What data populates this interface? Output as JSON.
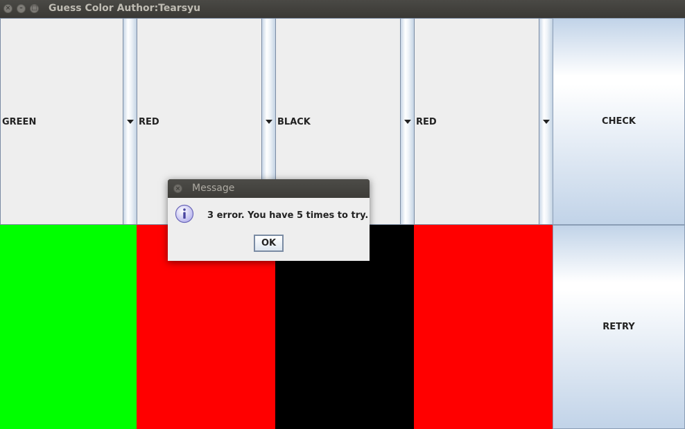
{
  "window": {
    "title": "Guess Color Author:Tearsyu",
    "controls": {
      "close": "×",
      "minimize": "–",
      "maximize": "□"
    }
  },
  "combos": [
    {
      "value": "GREEN"
    },
    {
      "value": "RED"
    },
    {
      "value": "BLACK"
    },
    {
      "value": "RED"
    }
  ],
  "buttons": {
    "check": "CHECK",
    "retry": "RETRY"
  },
  "swatches": [
    {
      "color": "#00ff00"
    },
    {
      "color": "#ff0000"
    },
    {
      "color": "#000000"
    },
    {
      "color": "#ff0000"
    }
  ],
  "dialog": {
    "title": "Message",
    "close": "×",
    "message": "3 error. You have 5 times to try.",
    "ok_label": "OK",
    "icon": "info-icon"
  }
}
